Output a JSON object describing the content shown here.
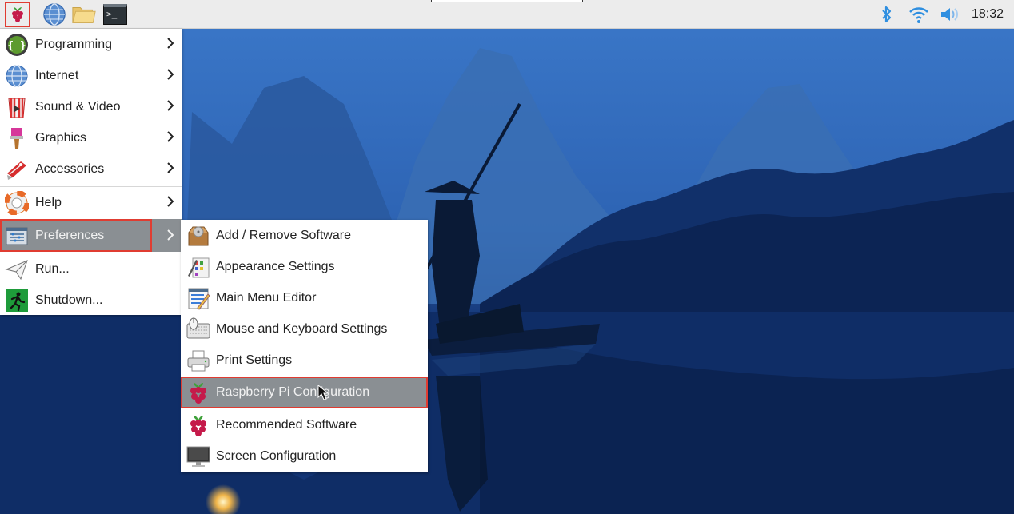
{
  "taskbar": {
    "launchers": [
      {
        "icon": "raspberry-menu-icon"
      },
      {
        "icon": "web-browser-globe-icon"
      },
      {
        "icon": "file-manager-folder-icon"
      },
      {
        "icon": "terminal-icon",
        "glyph": ">_"
      }
    ],
    "tray": {
      "bluetooth_icon": "bluetooth-icon",
      "wifi_icon": "wifi-icon",
      "volume_icon": "volume-icon",
      "clock": "18:32"
    }
  },
  "main_menu": {
    "items": [
      {
        "label": "Programming",
        "icon": "programming-icon",
        "submenu": true
      },
      {
        "label": "Internet",
        "icon": "internet-icon",
        "submenu": true
      },
      {
        "label": "Sound & Video",
        "icon": "sound-video-icon",
        "submenu": true
      },
      {
        "label": "Graphics",
        "icon": "graphics-icon",
        "submenu": true
      },
      {
        "label": "Accessories",
        "icon": "accessories-icon",
        "submenu": true
      },
      {
        "label": "Help",
        "icon": "help-icon",
        "submenu": true
      },
      {
        "label": "Preferences",
        "icon": "preferences-icon",
        "submenu": true,
        "selected": true
      },
      {
        "label": "Run...",
        "icon": "run-icon",
        "submenu": false
      },
      {
        "label": "Shutdown...",
        "icon": "shutdown-icon",
        "submenu": false
      }
    ]
  },
  "preferences_menu": {
    "items": [
      {
        "label": "Add / Remove Software",
        "icon": "add-remove-software-icon"
      },
      {
        "label": "Appearance Settings",
        "icon": "appearance-settings-icon"
      },
      {
        "label": "Main Menu Editor",
        "icon": "main-menu-editor-icon"
      },
      {
        "label": "Mouse and Keyboard Settings",
        "icon": "mouse-keyboard-icon"
      },
      {
        "label": "Print Settings",
        "icon": "printer-icon"
      },
      {
        "label": "Raspberry Pi Configuration",
        "icon": "raspberry-pi-config-icon",
        "selected": true
      },
      {
        "label": "Recommended Software",
        "icon": "recommended-software-icon"
      },
      {
        "label": "Screen Configuration",
        "icon": "screen-configuration-icon"
      }
    ]
  },
  "colors": {
    "highlight": "#8a8f93",
    "outline": "#e03c31",
    "taskbar": "#ececec",
    "tray_blue": "#2f8fe0"
  }
}
